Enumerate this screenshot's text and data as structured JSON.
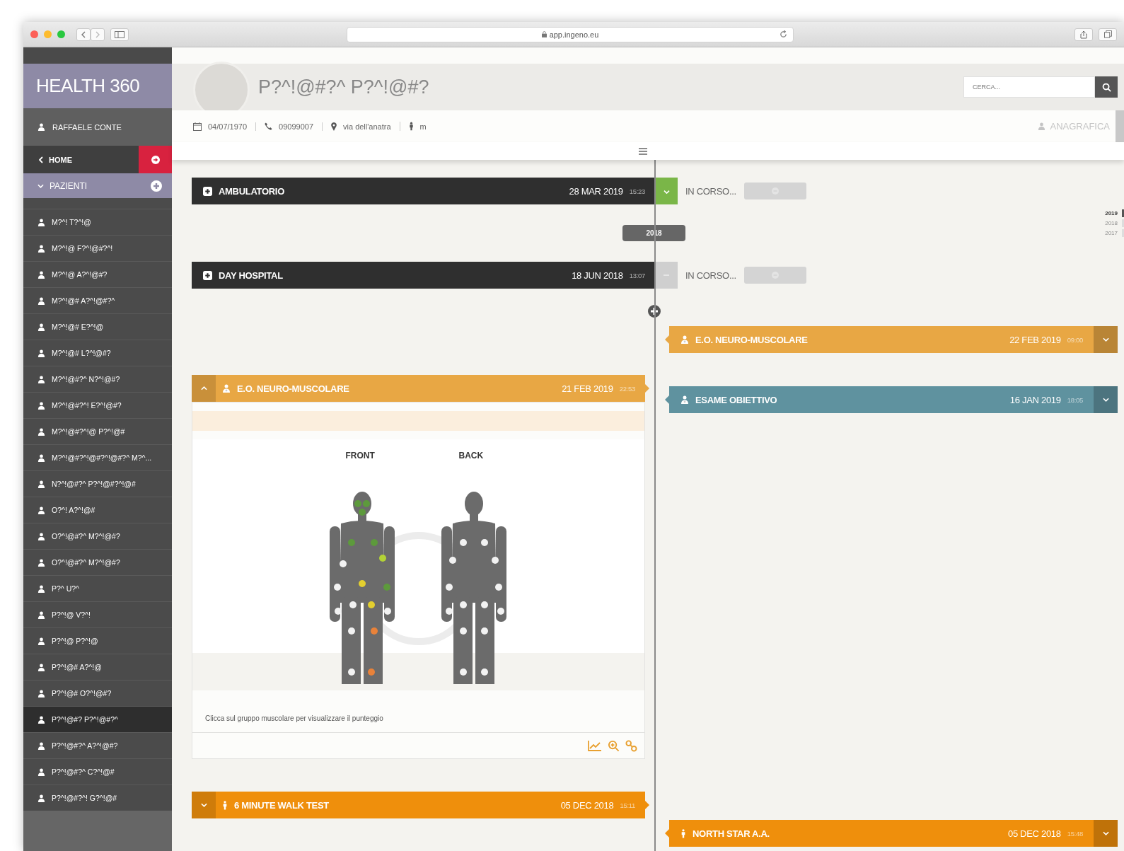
{
  "browser": {
    "url": "app.ingeno.eu"
  },
  "sidebar": {
    "brand": "HEALTH 360",
    "user": "RAFFAELE CONTE",
    "home": "HOME",
    "section": {
      "label": "PAZIENTI",
      "expanded": true
    },
    "patients": [
      {
        "name": "M?^! T?^!@",
        "selected": false
      },
      {
        "name": "M?^!@ F?^!@#?^!",
        "selected": false
      },
      {
        "name": "M?^!@ A?^!@#?",
        "selected": false
      },
      {
        "name": "M?^!@# A?^!@#?^",
        "selected": false
      },
      {
        "name": "M?^!@# E?^!@",
        "selected": false
      },
      {
        "name": "M?^!@# L?^!@#?",
        "selected": false
      },
      {
        "name": "M?^!@#?^ N?^!@#?",
        "selected": false
      },
      {
        "name": "M?^!@#?^! E?^!@#?",
        "selected": false
      },
      {
        "name": "M?^!@#?^!@ P?^!@#",
        "selected": false
      },
      {
        "name": "M?^!@#?^!@#?^!@#?^ M?^...",
        "selected": false
      },
      {
        "name": "N?^!@#?^ P?^!@#?^!@#",
        "selected": false
      },
      {
        "name": "O?^! A?^!@#",
        "selected": false
      },
      {
        "name": "O?^!@#?^ M?^!@#?",
        "selected": false
      },
      {
        "name": "O?^!@#?^ M?^!@#?",
        "selected": false
      },
      {
        "name": "P?^ U?^",
        "selected": false
      },
      {
        "name": "P?^!@ V?^!",
        "selected": false
      },
      {
        "name": "P?^!@ P?^!@",
        "selected": false
      },
      {
        "name": "P?^!@# A?^!@",
        "selected": false
      },
      {
        "name": "P?^!@# O?^!@#?",
        "selected": false
      },
      {
        "name": "P?^!@#? P?^!@#?^",
        "selected": true
      },
      {
        "name": "P?^!@#?^ A?^!@#?",
        "selected": false
      },
      {
        "name": "P?^!@#?^ C?^!@#",
        "selected": false
      },
      {
        "name": "P?^!@#?^! G?^!@#",
        "selected": false
      }
    ]
  },
  "patient": {
    "name": "P?^!@#?^ P?^!@#?",
    "birth_date": "04/07/1970",
    "phone": "09099007",
    "address": "via dell'anatra",
    "sex": "m"
  },
  "search": {
    "placeholder": "CERCA..."
  },
  "anagrafica": "ANAGRAFICA",
  "years": [
    {
      "label": "2019",
      "selected": true
    },
    {
      "label": "2018",
      "selected": false
    },
    {
      "label": "2017",
      "selected": false
    }
  ],
  "timeline": {
    "left": [
      {
        "kind": "visit",
        "title": "AMBULATORIO",
        "date": "28 MAR 2019",
        "time": "15:23",
        "color": "#2f2f2f",
        "confirmed": true,
        "status": "IN CORSO..."
      },
      {
        "kind": "year",
        "label": "2018"
      },
      {
        "kind": "visit",
        "title": "DAY HOSPITAL",
        "date": "18 JUN 2018",
        "time": "13:07",
        "color": "#2f2f2f",
        "confirmed": false,
        "status": "IN CORSO..."
      },
      {
        "kind": "exam",
        "title": "E.O. NEURO-MUSCOLARE",
        "date": "21 FEB 2019",
        "time": "22:53",
        "color": "#e8a744",
        "expanded": true,
        "detail": {
          "front_label": "FRONT",
          "back_label": "BACK",
          "caption": "Clicca sul gruppo muscolare per visualizzare il punteggio"
        }
      },
      {
        "kind": "test",
        "title": "6 MINUTE WALK TEST",
        "date": "05 DEC 2018",
        "time": "15:11",
        "color": "#ef8f0c",
        "expanded": false
      }
    ],
    "right": [
      {
        "kind": "exam",
        "title": "E.O. NEURO-MUSCOLARE",
        "date": "22 FEB 2019",
        "time": "09:00",
        "color": "#e8a744"
      },
      {
        "kind": "exam",
        "title": "ESAME OBIETTIVO",
        "date": "16 JAN 2019",
        "time": "18:05",
        "color": "#5f929f"
      },
      {
        "kind": "test",
        "title": "NORTH STAR A.A.",
        "date": "05 DEC 2018",
        "time": "15:48",
        "color": "#ef8f0c"
      }
    ]
  }
}
